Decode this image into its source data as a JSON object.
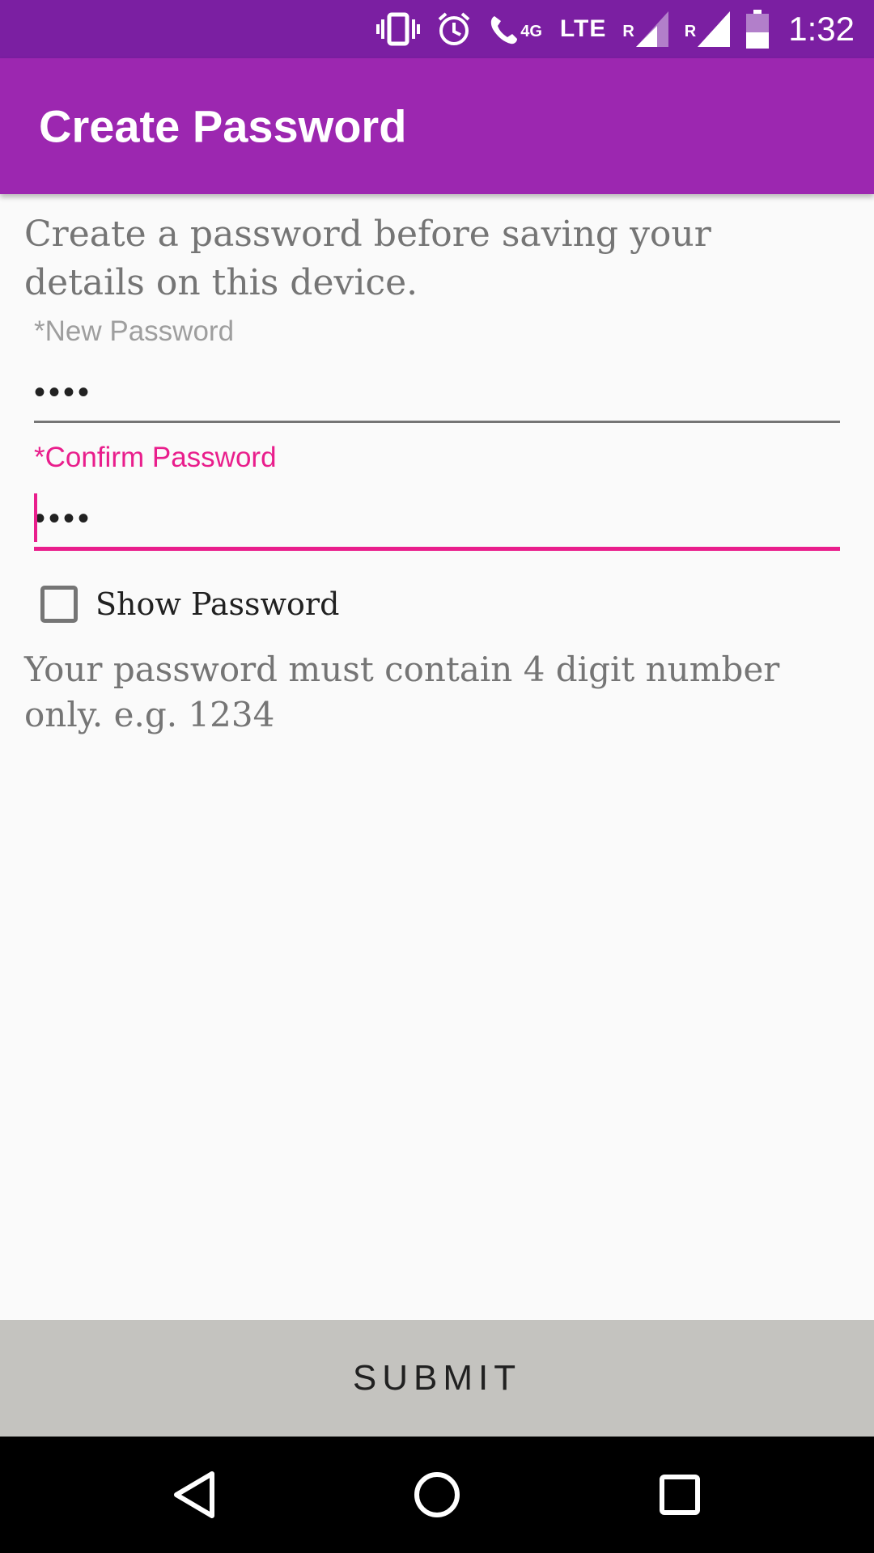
{
  "status_bar": {
    "network_label": "4G",
    "lte_label": "LTE",
    "roaming_1": "R",
    "roaming_2": "R",
    "time": "1:32",
    "icons": [
      "vibrate-icon",
      "alarm-icon",
      "wifi-call-icon",
      "signal-icon",
      "signal-icon",
      "battery-icon"
    ]
  },
  "app_bar": {
    "title": "Create Password",
    "color": "#9c27b0"
  },
  "form": {
    "intro": "Create a password before saving your details on this device.",
    "new_password": {
      "label": "*New Password",
      "value": "••••"
    },
    "confirm_password": {
      "label": "*Confirm Password",
      "value": "••••"
    },
    "show_password": {
      "label": "Show Password",
      "checked": false
    },
    "hint": "Your password must contain 4 digit number only. e.g. 1234"
  },
  "submit": {
    "label": "SUBMIT"
  },
  "nav_bar": {
    "icons": [
      "back-icon",
      "home-icon",
      "recents-icon"
    ]
  },
  "colors": {
    "status_bar": "#7b1fa2",
    "accent": "#e91e8c",
    "submit_bg": "#c4c3bf"
  }
}
